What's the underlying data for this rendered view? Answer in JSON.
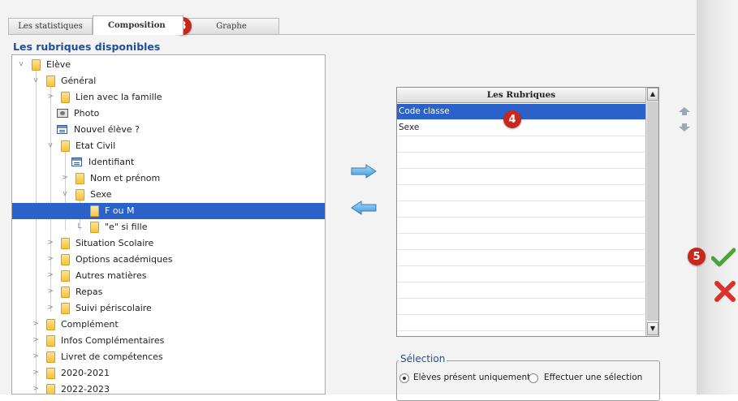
{
  "tabs": [
    {
      "label": "Les statistiques"
    },
    {
      "label": "Composition"
    },
    {
      "label": "Graphe"
    }
  ],
  "badges": {
    "tab": "3",
    "list": "4",
    "validate": "5"
  },
  "panel_title": "Les rubriques disponibles",
  "tree": [
    {
      "label": "Elève"
    },
    {
      "label": "Général"
    },
    {
      "label": "Lien avec la famille"
    },
    {
      "label": "Photo"
    },
    {
      "label": "Nouvel élève ?"
    },
    {
      "label": "Etat Civil"
    },
    {
      "label": "Identifiant"
    },
    {
      "label": "Nom et prénom"
    },
    {
      "label": "Sexe"
    },
    {
      "label": "F ou M"
    },
    {
      "label": "\"e\" si fille"
    },
    {
      "label": "Situation Scolaire"
    },
    {
      "label": "Options académiques"
    },
    {
      "label": "Autres matières"
    },
    {
      "label": "Repas"
    },
    {
      "label": "Suivi périscolaire"
    },
    {
      "label": "Complément"
    },
    {
      "label": "Infos Complémentaires"
    },
    {
      "label": "Livret de compétences"
    },
    {
      "label": "2020-2021"
    },
    {
      "label": "2022-2023"
    }
  ],
  "list": {
    "header": "Les Rubriques",
    "rows": [
      "Code classe",
      "Sexe"
    ]
  },
  "selection": {
    "legend": "Sélection",
    "option1": "Elèves présent uniquement",
    "option2": "Effectuer une sélection"
  },
  "colors": {
    "accent": "#2a62c9",
    "title": "#1f4f9a",
    "badge": "#c8281c",
    "ok": "#4aa43a",
    "cancel": "#d8322a"
  }
}
